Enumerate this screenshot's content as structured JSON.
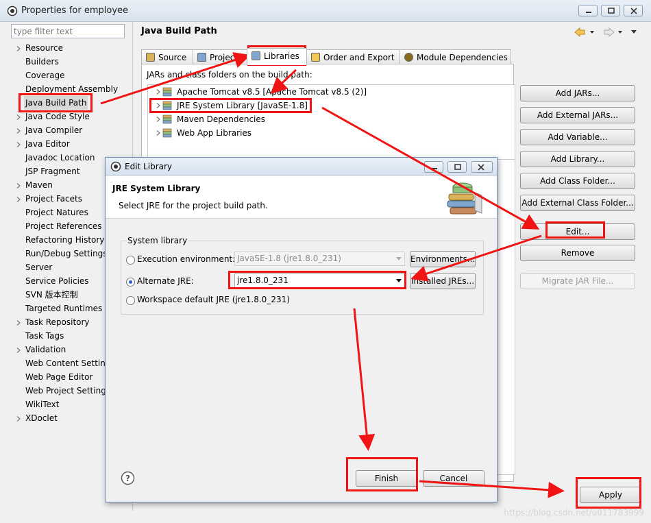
{
  "window": {
    "title": "Properties for employee"
  },
  "filter": {
    "placeholder": "type filter text"
  },
  "left_tree": [
    {
      "label": "Resource",
      "expandable": true
    },
    {
      "label": "Builders",
      "expandable": false
    },
    {
      "label": "Coverage",
      "expandable": false
    },
    {
      "label": "Deployment Assembly",
      "expandable": false
    },
    {
      "label": "Java Build Path",
      "expandable": false,
      "selected": true
    },
    {
      "label": "Java Code Style",
      "expandable": true
    },
    {
      "label": "Java Compiler",
      "expandable": true
    },
    {
      "label": "Java Editor",
      "expandable": true
    },
    {
      "label": "Javadoc Location",
      "expandable": false
    },
    {
      "label": "JSP Fragment",
      "expandable": false
    },
    {
      "label": "Maven",
      "expandable": true
    },
    {
      "label": "Project Facets",
      "expandable": true
    },
    {
      "label": "Project Natures",
      "expandable": false
    },
    {
      "label": "Project References",
      "expandable": false
    },
    {
      "label": "Refactoring History",
      "expandable": false
    },
    {
      "label": "Run/Debug Settings",
      "expandable": false
    },
    {
      "label": "Server",
      "expandable": false
    },
    {
      "label": "Service Policies",
      "expandable": false
    },
    {
      "label": "SVN 版本控制",
      "expandable": false
    },
    {
      "label": "Targeted Runtimes",
      "expandable": false
    },
    {
      "label": "Task Repository",
      "expandable": true
    },
    {
      "label": "Task Tags",
      "expandable": false
    },
    {
      "label": "Validation",
      "expandable": true
    },
    {
      "label": "Web Content Settings",
      "expandable": false
    },
    {
      "label": "Web Page Editor",
      "expandable": false
    },
    {
      "label": "Web Project Settings",
      "expandable": false
    },
    {
      "label": "WikiText",
      "expandable": false
    },
    {
      "label": "XDoclet",
      "expandable": true
    }
  ],
  "page": {
    "title": "Java Build Path"
  },
  "tabs": [
    {
      "label": "Source",
      "icon": "source-folder-icon"
    },
    {
      "label": "Projects",
      "icon": "projects-icon"
    },
    {
      "label": "Libraries",
      "icon": "libraries-icon",
      "active": true
    },
    {
      "label": "Order and Export",
      "icon": "order-export-icon"
    },
    {
      "label": "Module Dependencies",
      "icon": "module-dependencies-icon"
    }
  ],
  "libraries": {
    "caption": "JARs and class folders on the build path:",
    "items": [
      "Apache Tomcat v8.5 [Apache Tomcat v8.5 (2)]",
      "JRE System Library [JavaSE-1.8]",
      "Maven Dependencies",
      "Web App Libraries"
    ]
  },
  "side_buttons": [
    {
      "label": "Add JARs...",
      "enabled": true
    },
    {
      "label": "Add External JARs...",
      "enabled": true
    },
    {
      "label": "Add Variable...",
      "enabled": true
    },
    {
      "label": "Add Library...",
      "enabled": true
    },
    {
      "label": "Add Class Folder...",
      "enabled": true
    },
    {
      "label": "Add External Class Folder...",
      "enabled": true
    },
    {
      "label": "Edit...",
      "enabled": true
    },
    {
      "label": "Remove",
      "enabled": true
    },
    {
      "label": "Migrate JAR File...",
      "enabled": false
    }
  ],
  "apply_label": "Apply",
  "dialog": {
    "title": "Edit Library",
    "heading": "JRE System Library",
    "description": "Select JRE for the project build path.",
    "group_title": "System library",
    "options": {
      "execution_env": {
        "label": "Execution environment:",
        "value": "JavaSE-1.8 (jre1.8.0_231)",
        "button": "Environments..."
      },
      "alternate_jre": {
        "label": "Alternate JRE:",
        "value": "jre1.8.0_231",
        "button": "Installed JREs...",
        "selected": true
      },
      "workspace_default": {
        "label": "Workspace default JRE (jre1.8.0_231)"
      }
    },
    "finish_label": "Finish",
    "cancel_label": "Cancel"
  },
  "watermark": "https://blog.csdn.net/u011783999",
  "annotation_color": "#f01414"
}
